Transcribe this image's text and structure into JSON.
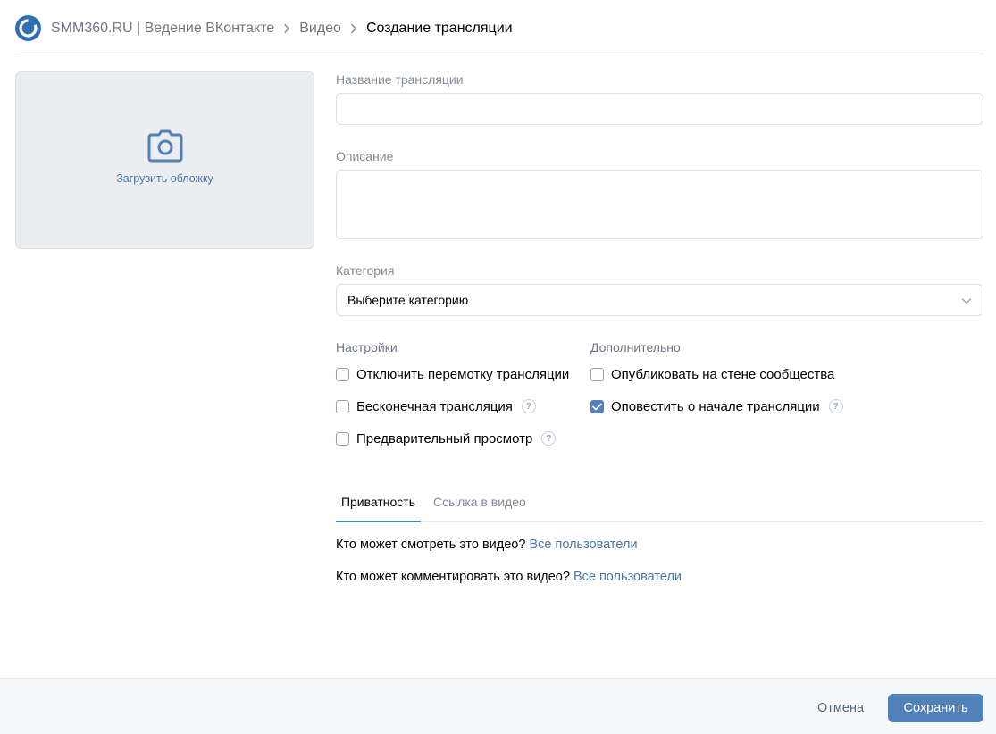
{
  "header": {
    "group_name": "SMM360.RU | Ведение ВКонтакте",
    "breadcrumb_video": "Видео",
    "breadcrumb_current": "Создание трансляции"
  },
  "cover": {
    "upload_label": "Загрузить обложку",
    "icon": "camera-icon"
  },
  "form": {
    "title_label": "Название трансляции",
    "title_value": "",
    "description_label": "Описание",
    "description_value": "",
    "category_label": "Категория",
    "category_value": "Выберите категорию"
  },
  "settings": {
    "title": "Настройки",
    "items": [
      {
        "label": "Отключить перемотку трансляции",
        "checked": false,
        "help": false
      },
      {
        "label": "Бесконечная трансляция",
        "checked": false,
        "help": true
      },
      {
        "label": "Предварительный просмотр",
        "checked": false,
        "help": true
      }
    ]
  },
  "additional": {
    "title": "Дополнительно",
    "items": [
      {
        "label": "Опубликовать на стене сообщества",
        "checked": false,
        "help": false
      },
      {
        "label": "Оповестить о начале трансляции",
        "checked": true,
        "help": true
      }
    ]
  },
  "tabs": {
    "privacy": "Приватность",
    "link": "Ссылка в видео"
  },
  "privacy": {
    "view_question": "Кто может смотреть это видео?",
    "view_value": "Все пользователи",
    "comment_question": "Кто может комментировать это видео?",
    "comment_value": "Все пользователи"
  },
  "footer": {
    "cancel": "Отмена",
    "save": "Сохранить"
  },
  "colors": {
    "accent": "#5181b8",
    "link": "#4a76a8"
  }
}
